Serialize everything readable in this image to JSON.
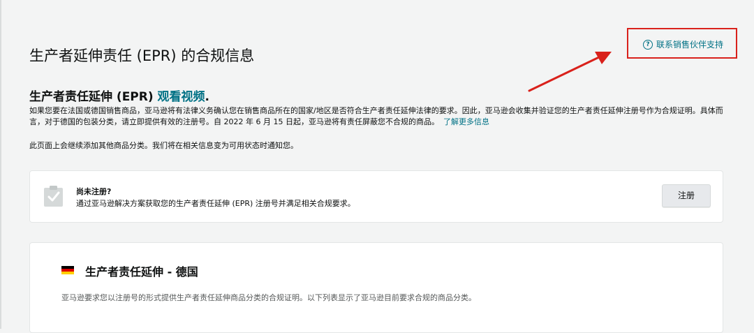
{
  "header": {
    "title": "生产者延伸责任 (EPR) 的合规信息",
    "support_link": "联系销售伙伴支持",
    "help_icon_glyph": "?"
  },
  "intro": {
    "heading": "生产者责任延伸 (EPR)",
    "video_link": "观看视频",
    "heading_suffix": ".",
    "description": "如果您要在法国或德国销售商品，亚马逊将有法律义务确认您在销售商品所在的国家/地区是否符合生产者责任延伸法律的要求。因此，亚马逊会收集并验证您的生产者责任延伸注册号作为合规证明。具体而言，对于德国的包装分类，请立即提供有效的注册号。自 2022 年 6 月 15 日起，亚马逊将有责任屏蔽您不合规的商品。",
    "learn_more": "了解更多信息",
    "note": "此页面上会继续添加其他商品分类。我们将在相关信息变为可用状态时通知您。"
  },
  "register_card": {
    "title": "尚未注册?",
    "subtitle": "通过亚马逊解决方案获取您的生产者责任延伸 (EPR) 注册号并满足相关合规要求。",
    "button": "注册",
    "icon": "clipboard-check-icon"
  },
  "germany_card": {
    "title": "生产者责任延伸 - 德国",
    "description": "亚马逊要求您以注册号的形式提供生产者责任延伸商品分类的合规证明。以下列表显示了亚马逊目前要求合规的商品分类。",
    "flag": "germany-flag-icon"
  },
  "colors": {
    "link": "#007185",
    "highlight_box": "#d9211b",
    "flag_black": "#000000",
    "flag_red": "#dd0000",
    "flag_gold": "#ffce00"
  }
}
